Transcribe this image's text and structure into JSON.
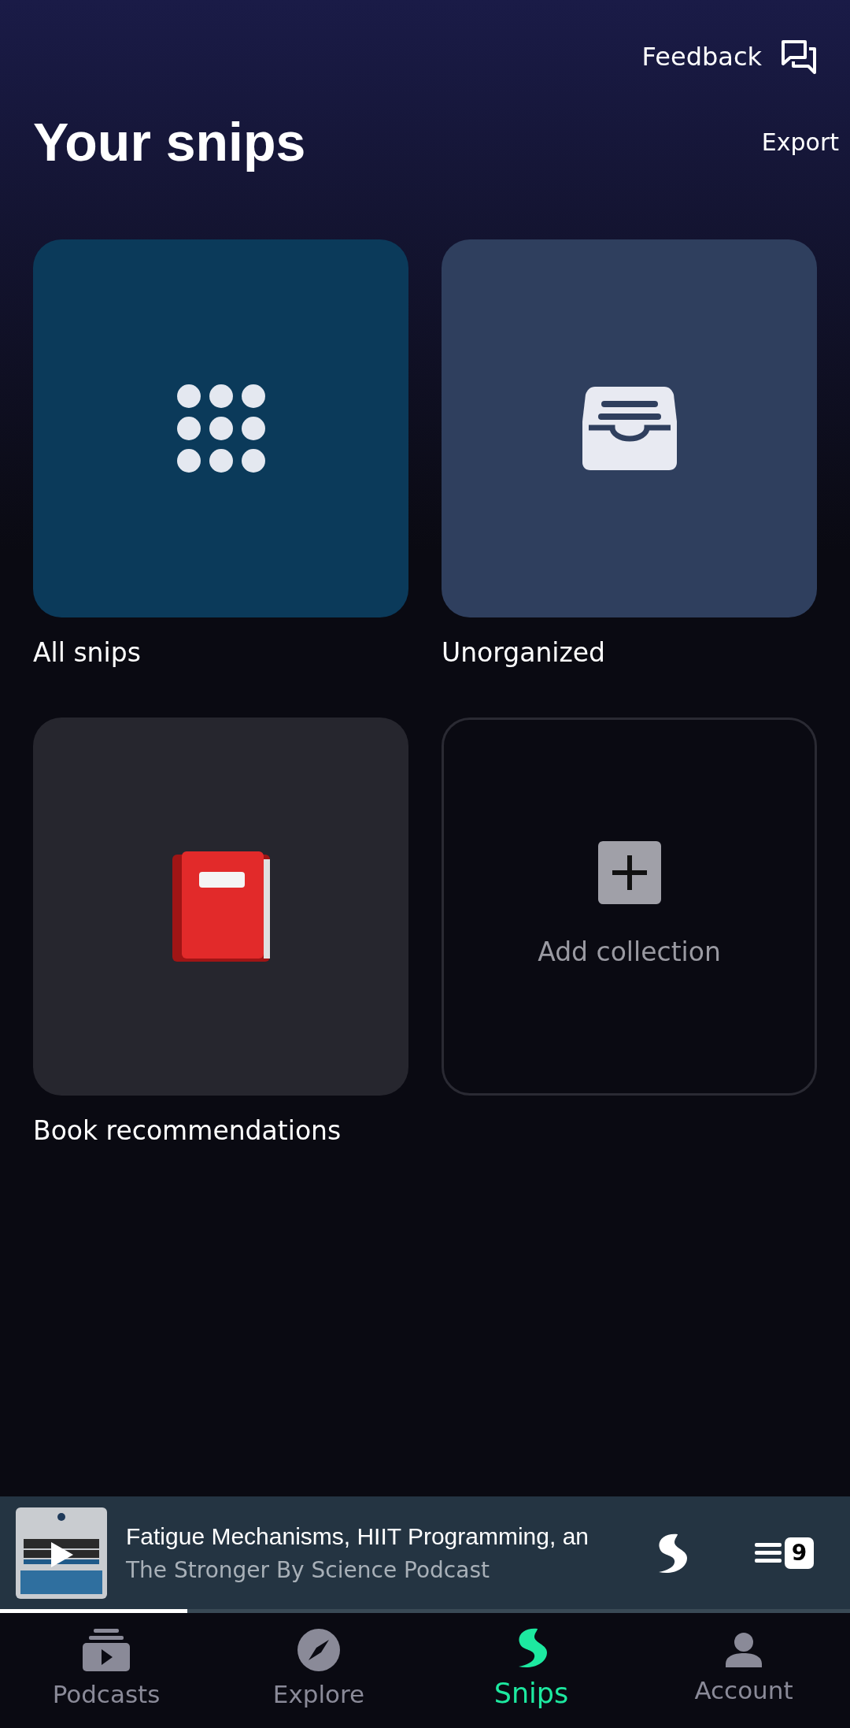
{
  "header": {
    "feedback": "Feedback",
    "title": "Your snips",
    "export": "Export"
  },
  "collections": [
    {
      "kind": "all",
      "label": "All snips"
    },
    {
      "kind": "unorganized",
      "label": "Unorganized"
    },
    {
      "kind": "book",
      "label": "Book recommendations"
    },
    {
      "kind": "add",
      "label": "Add collection"
    }
  ],
  "player": {
    "title": "Fatigue Mechanisms, HIIT Programming, an",
    "podcast": "The Stronger By Science Podcast",
    "queue_count": "9",
    "level": 0.22
  },
  "nav": [
    {
      "kind": "podcasts",
      "label": "Podcasts",
      "selected": false
    },
    {
      "kind": "explore",
      "label": "Explore",
      "selected": false
    },
    {
      "kind": "snips",
      "label": "Snips",
      "selected": true
    },
    {
      "kind": "account",
      "label": "Account",
      "selected": false
    }
  ]
}
